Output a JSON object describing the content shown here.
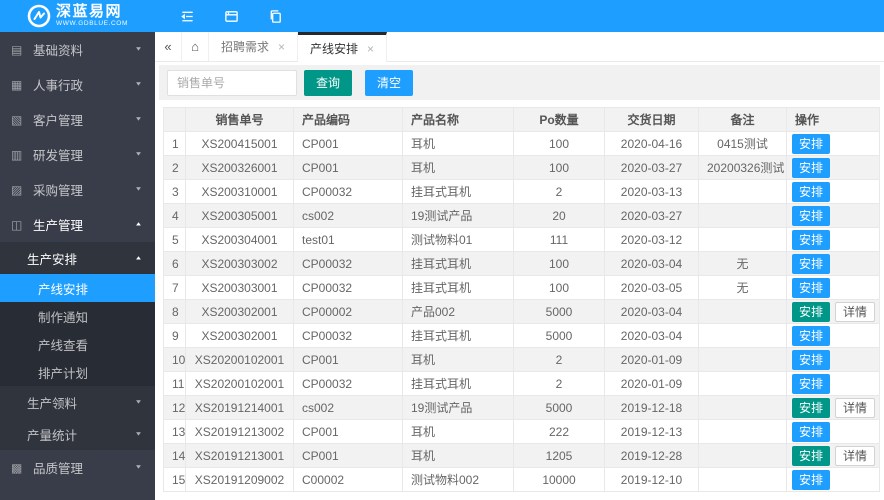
{
  "colors": {
    "accent": "#1e9fff",
    "green": "#009688",
    "sidebar_bg": "#393d49",
    "submenu_bg": "#30343d",
    "submenu2_bg": "#282c34",
    "active_tab_border": "#23292e",
    "toolbar_bg": "#f1f1f1",
    "table_border": "#e8e8e8",
    "stripe": "#f2f2f2"
  },
  "header": {
    "brand": {
      "title": "深蓝易网",
      "subtitle": "WWW.GDBLUE.COM"
    },
    "icons": [
      {
        "key": "collapse-sidebar",
        "icon": "outline-list-icon"
      },
      {
        "key": "refresh-window",
        "icon": "window-icon"
      },
      {
        "key": "copy-page",
        "icon": "copy-icon"
      }
    ]
  },
  "sidebar": {
    "items": [
      {
        "key": "basic-data",
        "label": "基础资料",
        "level": 1,
        "icon": "folder-icon",
        "arrow": "down"
      },
      {
        "key": "hr-admin",
        "label": "人事行政",
        "level": 1,
        "icon": "grid-icon",
        "arrow": "down"
      },
      {
        "key": "customer-mgmt",
        "label": "客户管理",
        "level": 1,
        "icon": "tools-icon",
        "arrow": "down"
      },
      {
        "key": "rd-mgmt",
        "label": "研发管理",
        "level": 1,
        "icon": "doc-icon",
        "arrow": "down"
      },
      {
        "key": "purchasing-mgmt",
        "label": "采购管理",
        "level": 1,
        "icon": "cart-icon",
        "arrow": "down"
      },
      {
        "key": "production-mgmt",
        "label": "生产管理",
        "level": 1,
        "icon": "file-icon",
        "arrow": "up",
        "open": true
      },
      {
        "key": "production-arrange",
        "label": "生产安排",
        "level": 2,
        "arrow": "up",
        "open": true
      },
      {
        "key": "line-arrange",
        "label": "产线安排",
        "level": 3,
        "active": true
      },
      {
        "key": "make-notice",
        "label": "制作通知",
        "level": 3
      },
      {
        "key": "line-view",
        "label": "产线查看",
        "level": 3
      },
      {
        "key": "scheduling-plan",
        "label": "排产计划",
        "level": 3
      },
      {
        "key": "production-material",
        "label": "生产领料",
        "level": 2,
        "arrow": "down"
      },
      {
        "key": "output-stats",
        "label": "产量统计",
        "level": 2,
        "arrow": "down"
      },
      {
        "key": "quality-mgmt",
        "label": "品质管理",
        "level": 1,
        "icon": "clipboard-icon",
        "arrow": "down"
      }
    ]
  },
  "tabbar": {
    "tabs": [
      {
        "key": "recruit-demand",
        "label": "招聘需求",
        "closable": true
      },
      {
        "key": "line-arrange",
        "label": "产线安排",
        "closable": true,
        "active": true
      }
    ]
  },
  "toolbar": {
    "search_placeholder": "销售单号",
    "query_label": "查询",
    "clear_label": "清空"
  },
  "table": {
    "columns": [
      {
        "label": "",
        "align": "center"
      },
      {
        "label": "销售单号",
        "align": "center"
      },
      {
        "label": "产品编码",
        "align": "left"
      },
      {
        "label": "产品名称",
        "align": "left"
      },
      {
        "label": "Po数量",
        "align": "center"
      },
      {
        "label": "交货日期",
        "align": "center"
      },
      {
        "label": "备注",
        "align": "center"
      },
      {
        "label": "操作",
        "align": "left"
      }
    ],
    "rows": [
      {
        "index": "1",
        "sale_no": "XS200415001",
        "product_code": "CP001",
        "product_name": "耳机",
        "po_qty": "100",
        "delivery_date": "2020-04-16",
        "remark": "0415测试",
        "actions": [
          {
            "label": "安排",
            "style": "blue"
          }
        ]
      },
      {
        "index": "2",
        "sale_no": "XS200326001",
        "product_code": "CP001",
        "product_name": "耳机",
        "po_qty": "100",
        "delivery_date": "2020-03-27",
        "remark": "20200326测试",
        "actions": [
          {
            "label": "安排",
            "style": "blue"
          }
        ]
      },
      {
        "index": "3",
        "sale_no": "XS200310001",
        "product_code": "CP00032",
        "product_name": "挂耳式耳机",
        "po_qty": "2",
        "delivery_date": "2020-03-13",
        "remark": "",
        "actions": [
          {
            "label": "安排",
            "style": "blue"
          }
        ]
      },
      {
        "index": "4",
        "sale_no": "XS200305001",
        "product_code": "cs002",
        "product_name": "19测试产品",
        "po_qty": "20",
        "delivery_date": "2020-03-27",
        "remark": "",
        "actions": [
          {
            "label": "安排",
            "style": "blue"
          }
        ]
      },
      {
        "index": "5",
        "sale_no": "XS200304001",
        "product_code": "test01",
        "product_name": "测试物料01",
        "po_qty": "111",
        "delivery_date": "2020-03-12",
        "remark": "",
        "actions": [
          {
            "label": "安排",
            "style": "blue"
          }
        ]
      },
      {
        "index": "6",
        "sale_no": "XS200303002",
        "product_code": "CP00032",
        "product_name": "挂耳式耳机",
        "po_qty": "100",
        "delivery_date": "2020-03-04",
        "remark": "无",
        "actions": [
          {
            "label": "安排",
            "style": "blue"
          }
        ]
      },
      {
        "index": "7",
        "sale_no": "XS200303001",
        "product_code": "CP00032",
        "product_name": "挂耳式耳机",
        "po_qty": "100",
        "delivery_date": "2020-03-05",
        "remark": "无",
        "actions": [
          {
            "label": "安排",
            "style": "blue"
          }
        ]
      },
      {
        "index": "8",
        "sale_no": "XS200302001",
        "product_code": "CP00002",
        "product_name": "产品002",
        "po_qty": "5000",
        "delivery_date": "2020-03-04",
        "remark": "",
        "actions": [
          {
            "label": "安排",
            "style": "green"
          },
          {
            "label": "详情",
            "style": "plain"
          }
        ]
      },
      {
        "index": "9",
        "sale_no": "XS200302001",
        "product_code": "CP00032",
        "product_name": "挂耳式耳机",
        "po_qty": "5000",
        "delivery_date": "2020-03-04",
        "remark": "",
        "actions": [
          {
            "label": "安排",
            "style": "blue"
          }
        ]
      },
      {
        "index": "10",
        "sale_no": "XS20200102001",
        "product_code": "CP001",
        "product_name": "耳机",
        "po_qty": "2",
        "delivery_date": "2020-01-09",
        "remark": "",
        "actions": [
          {
            "label": "安排",
            "style": "blue"
          }
        ]
      },
      {
        "index": "11",
        "sale_no": "XS20200102001",
        "product_code": "CP00032",
        "product_name": "挂耳式耳机",
        "po_qty": "2",
        "delivery_date": "2020-01-09",
        "remark": "",
        "actions": [
          {
            "label": "安排",
            "style": "blue"
          }
        ]
      },
      {
        "index": "12",
        "sale_no": "XS20191214001",
        "product_code": "cs002",
        "product_name": "19测试产品",
        "po_qty": "5000",
        "delivery_date": "2019-12-18",
        "remark": "",
        "actions": [
          {
            "label": "安排",
            "style": "green"
          },
          {
            "label": "详情",
            "style": "plain"
          }
        ]
      },
      {
        "index": "13",
        "sale_no": "XS20191213002",
        "product_code": "CP001",
        "product_name": "耳机",
        "po_qty": "222",
        "delivery_date": "2019-12-13",
        "remark": "",
        "actions": [
          {
            "label": "安排",
            "style": "blue"
          }
        ]
      },
      {
        "index": "14",
        "sale_no": "XS20191213001",
        "product_code": "CP001",
        "product_name": "耳机",
        "po_qty": "1205",
        "delivery_date": "2019-12-28",
        "remark": "",
        "actions": [
          {
            "label": "安排",
            "style": "green"
          },
          {
            "label": "详情",
            "style": "plain"
          }
        ]
      },
      {
        "index": "15",
        "sale_no": "XS20191209002",
        "product_code": "C00002",
        "product_name": "测试物料002",
        "po_qty": "10000",
        "delivery_date": "2019-12-10",
        "remark": "",
        "actions": [
          {
            "label": "安排",
            "style": "blue"
          }
        ]
      }
    ]
  }
}
